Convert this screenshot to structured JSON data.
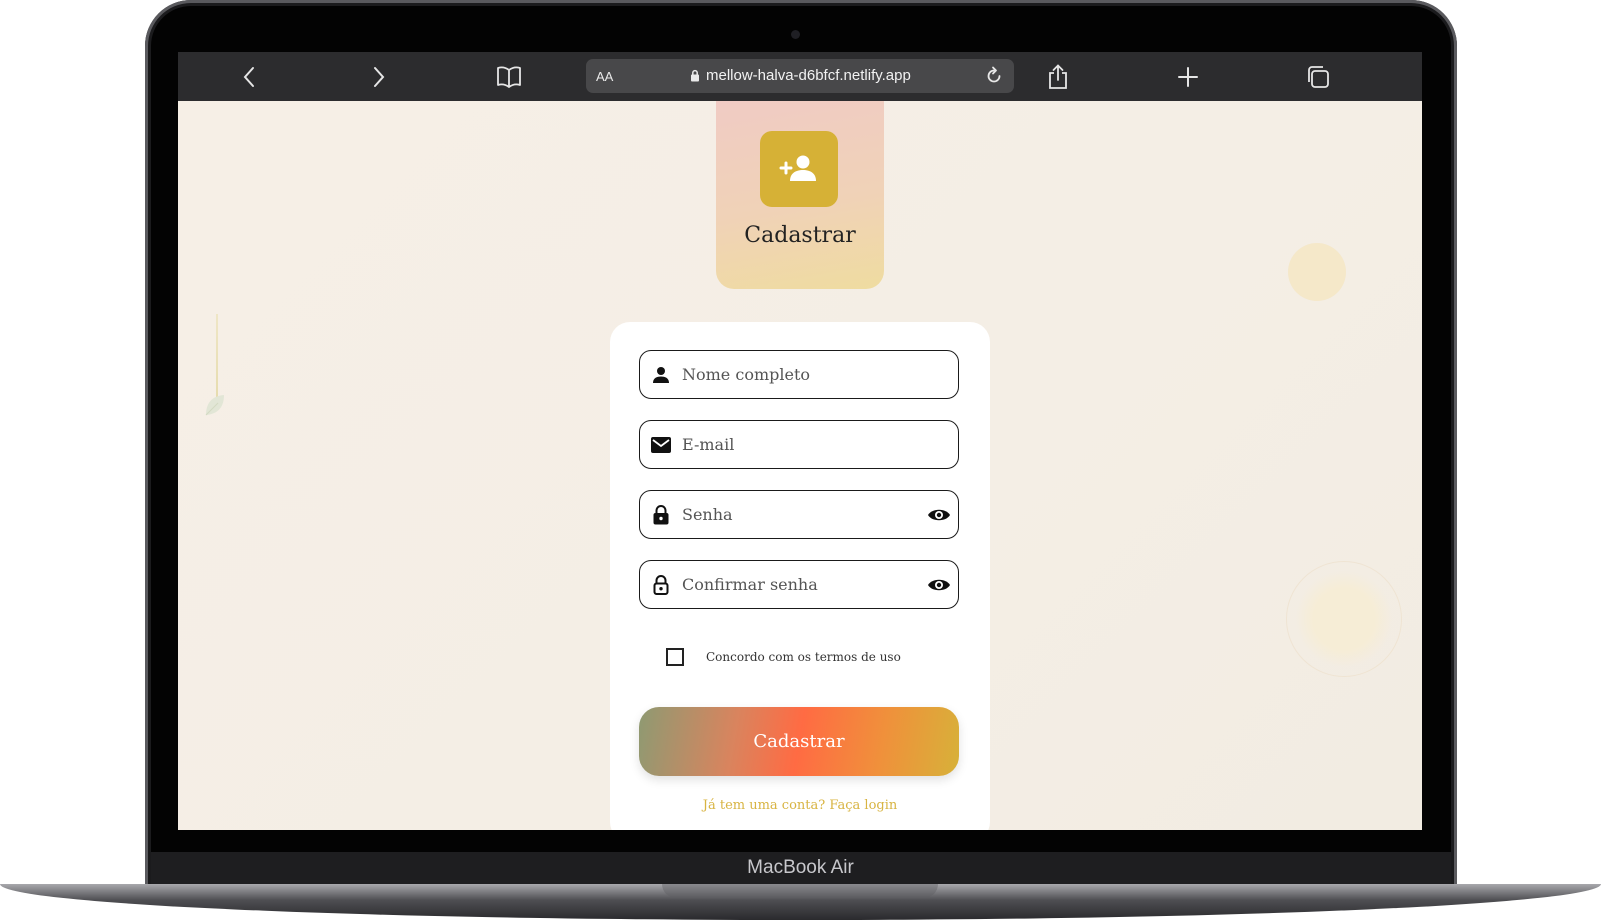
{
  "device": {
    "label": "MacBook Air"
  },
  "browser": {
    "url": "mellow-halva-d6bfcf.netlify.app",
    "text_size_label": "AA",
    "icons": [
      "back-icon",
      "forward-icon",
      "book-icon",
      "lock-icon",
      "reload-icon",
      "share-icon",
      "plus-icon",
      "tabs-icon"
    ]
  },
  "header": {
    "title": "Cadastrar",
    "icon": "add-user-icon"
  },
  "form": {
    "fields": [
      {
        "placeholder": "Nome completo",
        "icon": "person-icon"
      },
      {
        "placeholder": "E-mail",
        "icon": "mail-icon"
      },
      {
        "placeholder": "Senha",
        "icon": "lock-icon",
        "toggle": "eye-icon"
      },
      {
        "placeholder": "Confirmar senha",
        "icon": "lock-open-icon",
        "toggle": "eye-icon"
      }
    ],
    "terms_label": "Concordo com os termos de uso",
    "submit_label": "Cadastrar",
    "login_link": "Já tem uma conta? Faça login"
  },
  "colors": {
    "accent": "#d6b136",
    "link": "#d8b442",
    "background": "#f5efe6"
  }
}
